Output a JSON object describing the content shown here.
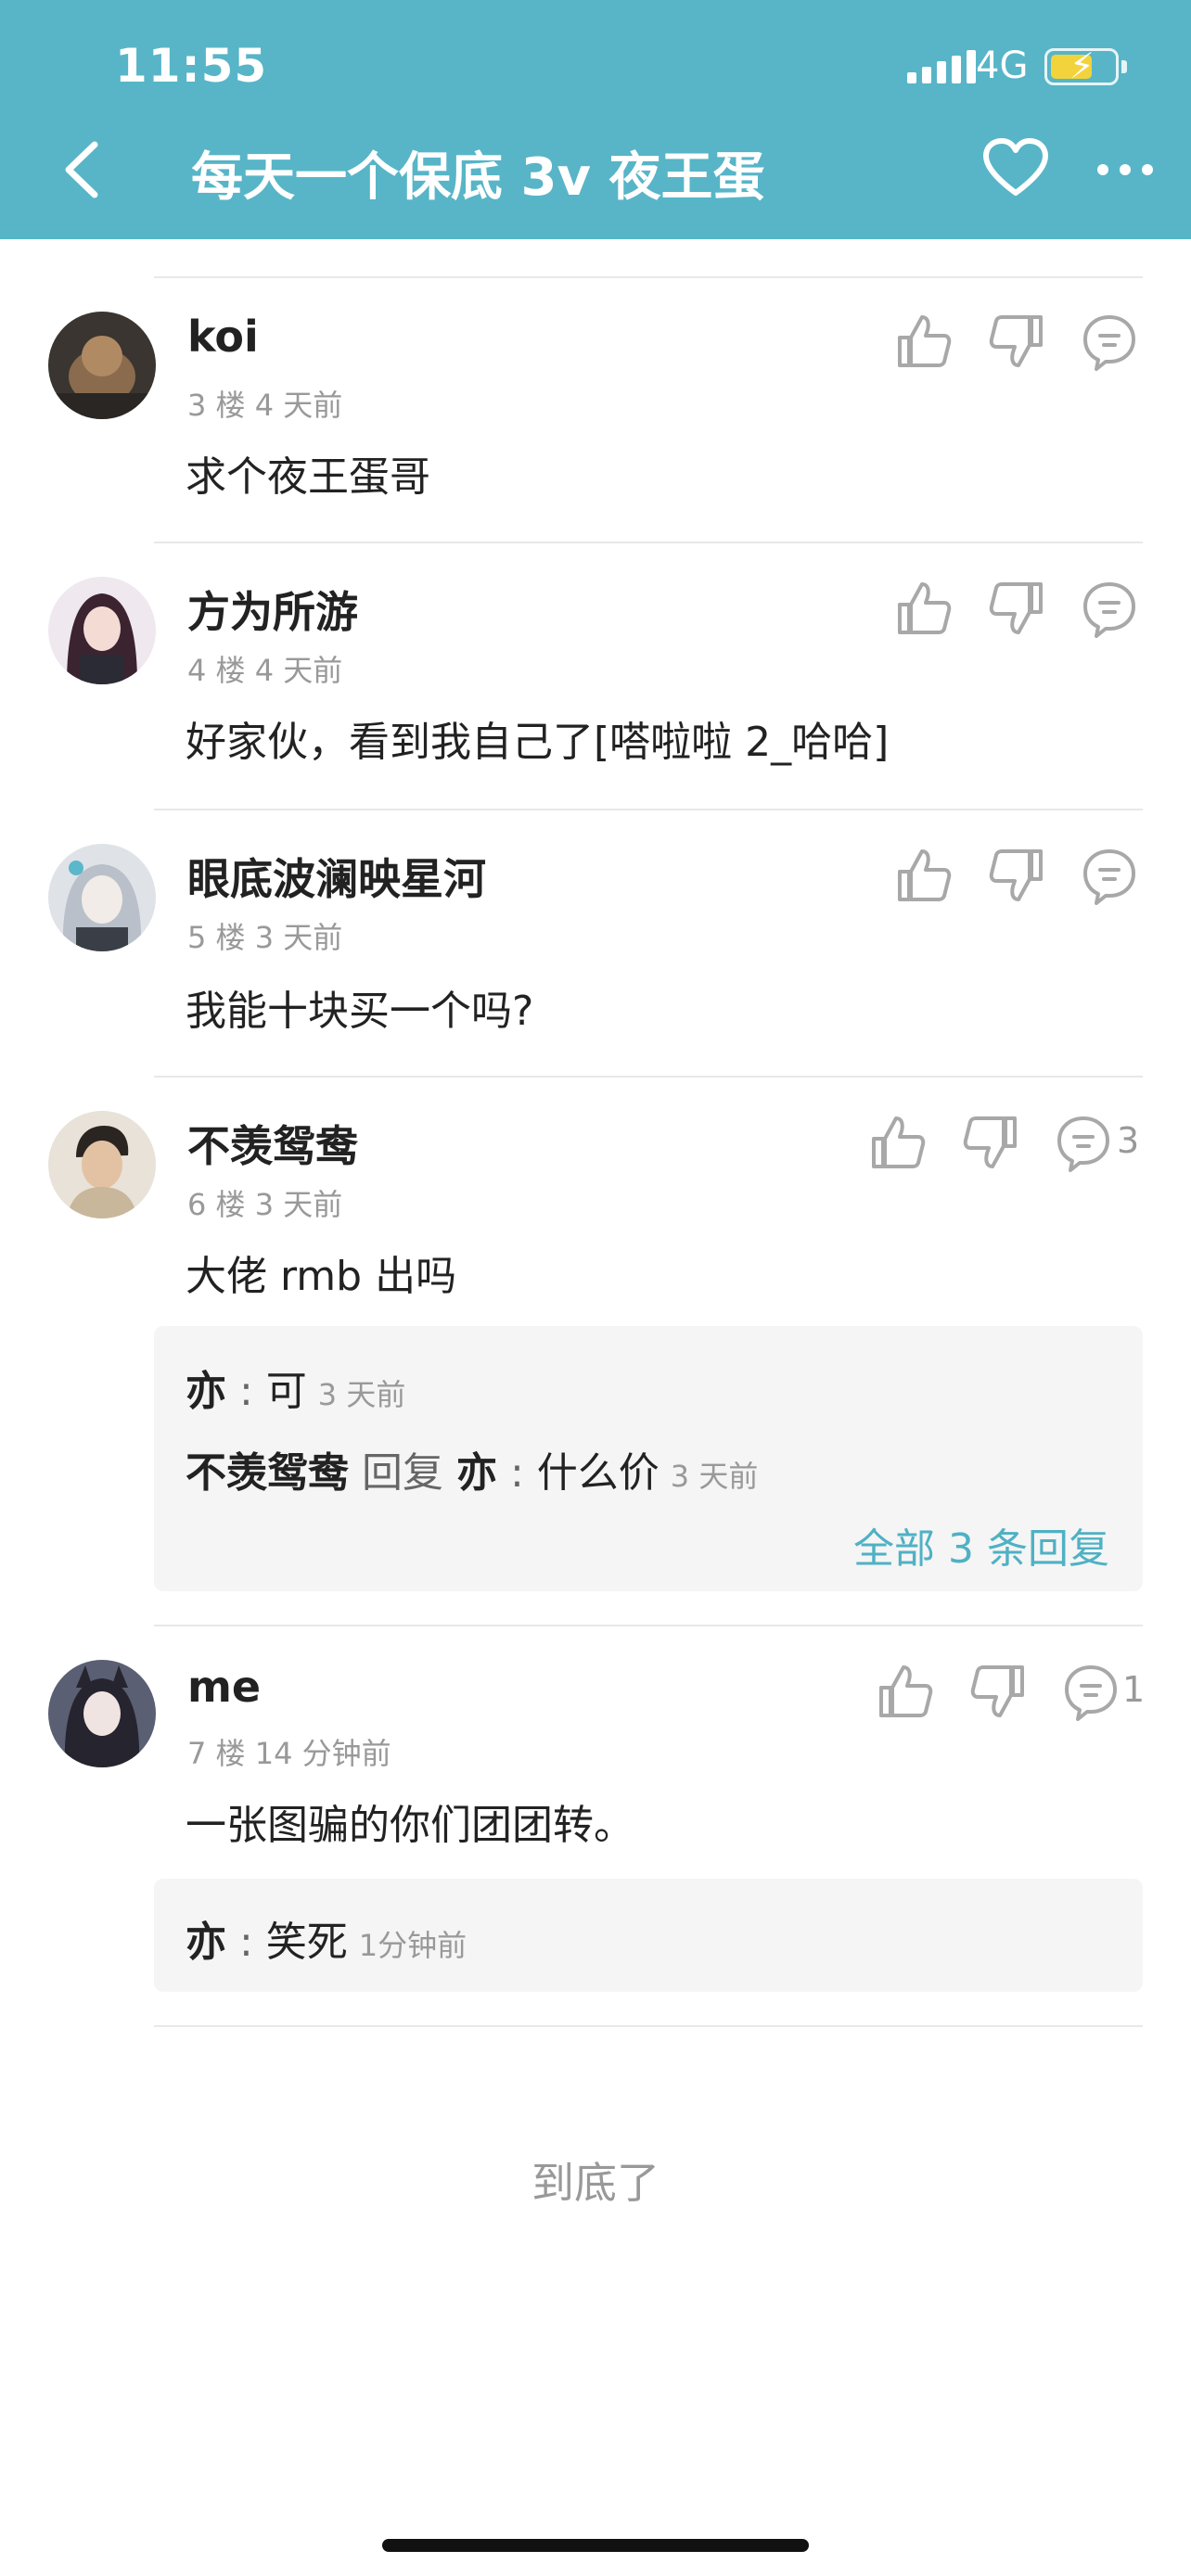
{
  "status_bar": {
    "time": "11:55",
    "network": "4G"
  },
  "header": {
    "title": "每天一个保底 3v 夜王蛋",
    "back_icon": "chevron-left-icon",
    "favorite_icon": "heart-icon",
    "more_icon": "more-icon"
  },
  "colors": {
    "accent": "#57b5c7",
    "link": "#4fb1c4",
    "battery": "#f3d33b"
  },
  "comments": [
    {
      "author": "koi",
      "meta": "3 楼 4 天前",
      "content": "求个夜王蛋哥",
      "reply_count": ""
    },
    {
      "author": "方为所游",
      "meta": "4 楼 4 天前",
      "content": "好家伙，看到我自己了[嗒啦啦 2_哈哈]",
      "reply_count": ""
    },
    {
      "author": "眼底波澜映星河",
      "meta": "5 楼 3 天前",
      "content": "我能十块买一个吗?",
      "reply_count": ""
    },
    {
      "author": "不羡鸳鸯",
      "meta": "6 楼 3 天前",
      "content": "大佬 rmb 出吗",
      "reply_count": "3",
      "replies": [
        {
          "name": "亦",
          "sep": " : ",
          "text": "可",
          "time": "3 天前"
        },
        {
          "name": "不羡鸳鸯",
          "mid": " 回复 ",
          "target": "亦",
          "sep": " : ",
          "text": "什么价",
          "time": "3 天前"
        }
      ],
      "all_replies": "全部 3 条回复"
    },
    {
      "author": "me",
      "meta": "7 楼 14 分钟前",
      "content": "一张图骗的你们团团转。",
      "reply_count": "1",
      "replies": [
        {
          "name": "亦",
          "sep": " : ",
          "text": "笑死",
          "time": "1分钟前"
        }
      ]
    }
  ],
  "footer": {
    "end_text": "到底了"
  }
}
